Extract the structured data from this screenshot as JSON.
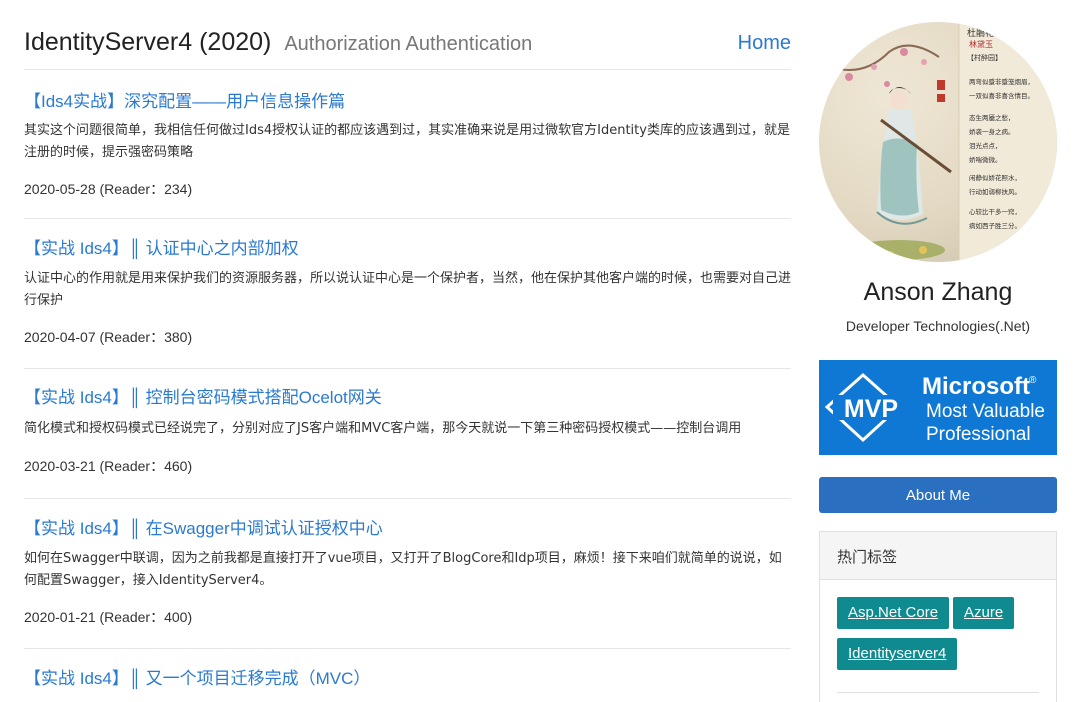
{
  "site": {
    "title": "IdentityServer4 (2020)",
    "subtitle": "Authorization Authentication",
    "home_link": "Home"
  },
  "posts": [
    {
      "title": "【Ids4实战】深究配置——用户信息操作篇",
      "excerpt": "其实这个问题很简单，我相信任何做过Ids4授权认证的都应该遇到过，其实准确来说是用过微软官方Identity类库的应该遇到过，就是注册的时候，提示强密码策略",
      "meta": "2020-05-28 (Reader：234)"
    },
    {
      "title": "【实战 Ids4】║ 认证中心之内部加权",
      "excerpt": "认证中心的作用就是用来保护我们的资源服务器，所以说认证中心是一个保护者，当然，他在保护其他客户端的时候，也需要对自己进行保护",
      "meta": "2020-04-07 (Reader：380)"
    },
    {
      "title": "【实战 Ids4】║ 控制台密码模式搭配Ocelot网关",
      "excerpt": "简化模式和授权码模式已经说完了，分别对应了JS客户端和MVC客户端，那今天就说一下第三种密码授权模式——控制台调用",
      "meta": "2020-03-21 (Reader：460)"
    },
    {
      "title": "【实战 Ids4】║ 在Swagger中调试认证授权中心",
      "excerpt": "如何在Swagger中联调，因为之前我都是直接打开了vue项目，又打开了BlogCore和Idp项目，麻烦！接下来咱们就简单的说说，如何配置Swagger，接入IdentityServer4。",
      "meta": "2020-01-21 (Reader：400)"
    },
    {
      "title": "【实战 Ids4】║ 又一个项目迁移完成（MVC）",
      "excerpt": "",
      "meta": ""
    }
  ],
  "sidebar": {
    "author_name": "Anson Zhang",
    "author_title": "Developer Technologies(.Net)",
    "mvp": {
      "badge": "MVP",
      "line1": "Microsoft",
      "line2": "Most Valuable",
      "line3": "Professional",
      "registered": "®"
    },
    "about_button": "About Me",
    "tags_title": "热门标签",
    "tags": [
      "Asp.Net Core",
      "Azure",
      "Identityserver4"
    ],
    "avatar_poem": {
      "heading": "杜鵑花",
      "name": "林黛玉",
      "bracket": "【村醉园】",
      "lines": [
        "两弯似蹙非蹙笼烟眉，",
        "一双似喜非喜含情目。",
        "态生两靥之愁，",
        "娇袭一身之病。",
        "泪光点点，",
        "娇喘微微。",
        "闲静似娇花照水，",
        "行动如弱柳扶风。",
        "心较比干多一窍，",
        "病如西子胜三分。"
      ]
    }
  },
  "colors": {
    "link": "#2a7ad2",
    "mvp_blue": "#0f78d4",
    "button_blue": "#2a6fc0",
    "tag_teal": "#0f8a8f"
  }
}
